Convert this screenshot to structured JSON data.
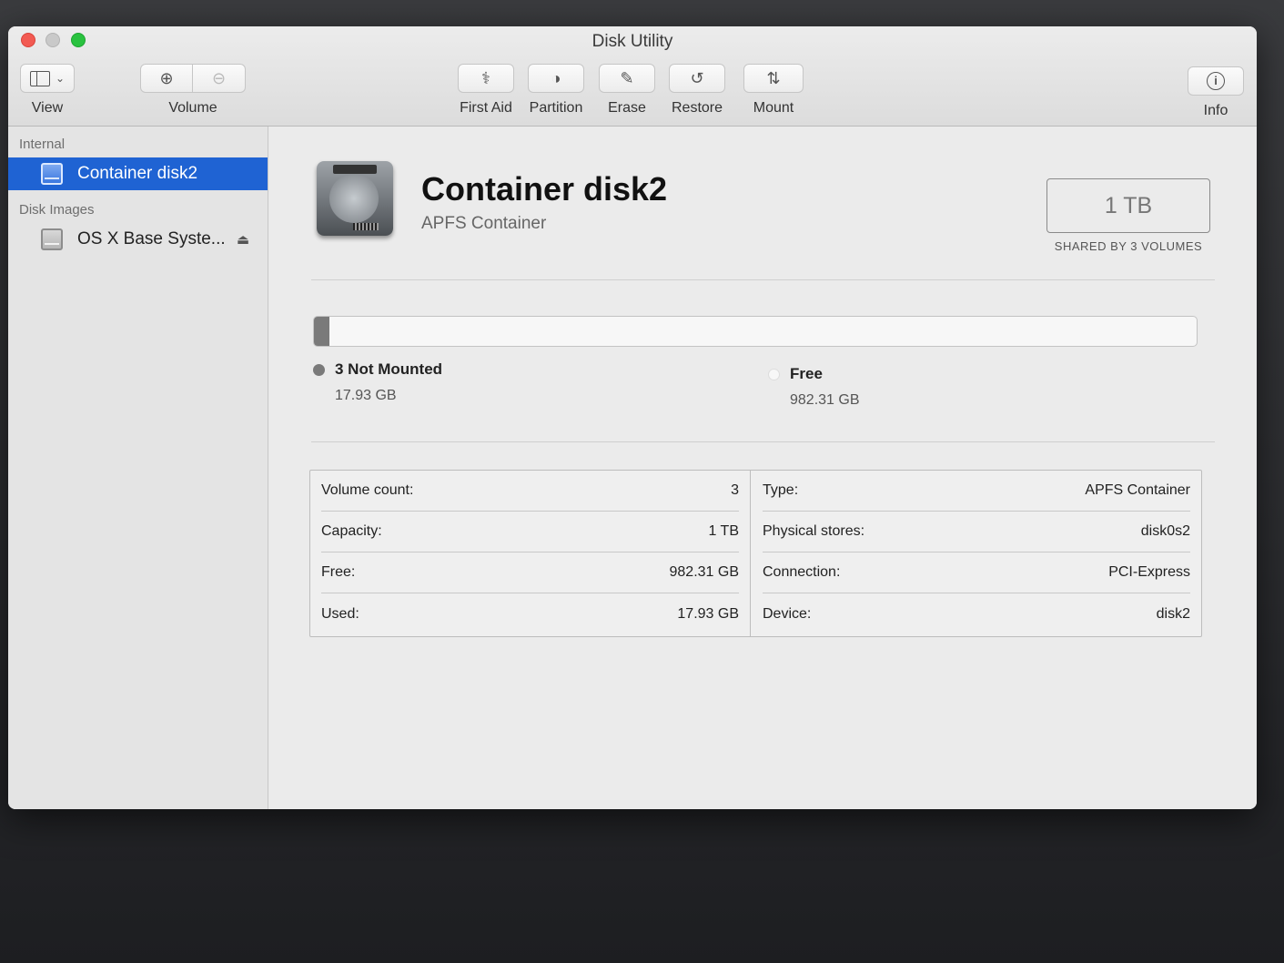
{
  "window": {
    "title": "Disk Utility"
  },
  "toolbar": {
    "view_label": "View",
    "volume_label": "Volume",
    "first_aid_label": "First Aid",
    "partition_label": "Partition",
    "erase_label": "Erase",
    "restore_label": "Restore",
    "mount_label": "Mount",
    "info_label": "Info"
  },
  "sidebar": {
    "sections": [
      {
        "header": "Internal",
        "items": [
          {
            "label": "Container disk2",
            "selected": true
          }
        ]
      },
      {
        "header": "Disk Images",
        "items": [
          {
            "label": "OS X Base Syste...",
            "selected": false
          }
        ]
      }
    ]
  },
  "detail": {
    "name": "Container disk2",
    "type": "APFS Container",
    "size": "1 TB",
    "size_caption": "SHARED BY 3 VOLUMES",
    "usage": {
      "used_fraction": 0.0179,
      "segments": [
        {
          "name": "3 Not Mounted",
          "value": "17.93 GB",
          "color": "#7a7a7a"
        },
        {
          "name": "Free",
          "value": "982.31 GB",
          "color": "#f7f7f7"
        }
      ]
    },
    "info_left": [
      {
        "label": "Volume count:",
        "value": "3"
      },
      {
        "label": "Capacity:",
        "value": "1 TB"
      },
      {
        "label": "Free:",
        "value": "982.31 GB"
      },
      {
        "label": "Used:",
        "value": "17.93 GB"
      }
    ],
    "info_right": [
      {
        "label": "Type:",
        "value": "APFS Container"
      },
      {
        "label": "Physical stores:",
        "value": "disk0s2"
      },
      {
        "label": "Connection:",
        "value": "PCI-Express"
      },
      {
        "label": "Device:",
        "value": "disk2"
      }
    ]
  },
  "colors": {
    "selection": "#1f63d3",
    "used_segment": "#7a7a7a"
  }
}
